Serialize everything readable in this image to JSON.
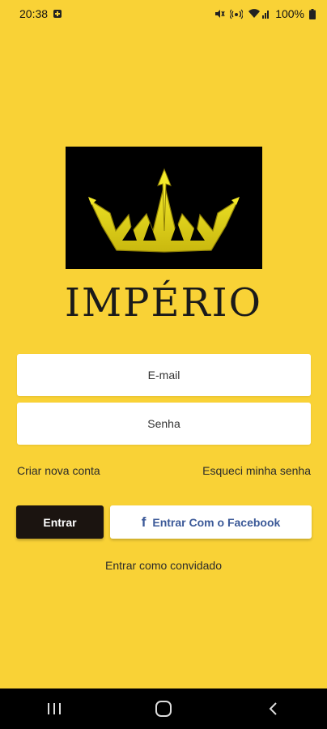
{
  "status_bar": {
    "time": "20:38",
    "battery": "100%"
  },
  "brand": {
    "name": "IMPÉRIO"
  },
  "form": {
    "email_placeholder": "E-mail",
    "password_placeholder": "Senha"
  },
  "links": {
    "create_account": "Criar nova conta",
    "forgot_password": "Esqueci minha senha",
    "guest": "Entrar como convidado"
  },
  "buttons": {
    "login": "Entrar",
    "facebook": "Entrar Com o Facebook"
  },
  "icons": {
    "facebook": "facebook-icon",
    "crown": "crown-icon"
  },
  "colors": {
    "background": "#F9D236",
    "primary_button": "#1b1410",
    "facebook_blue": "#3b5998",
    "logo_bg": "#000000",
    "crown_gold": "#E8D61F"
  }
}
